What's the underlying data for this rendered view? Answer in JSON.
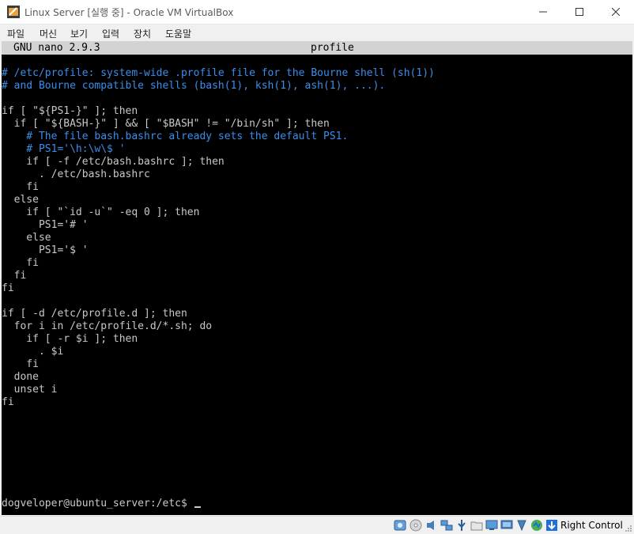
{
  "window": {
    "title": "Linux Server [실행 중] - Oracle VM VirtualBox"
  },
  "menu": {
    "items": [
      "파일",
      "머신",
      "보기",
      "입력",
      "장치",
      "도움말"
    ]
  },
  "nano": {
    "version": "GNU nano 2.9.3",
    "filename": "profile"
  },
  "file_lines": [
    "# /etc/profile: system-wide .profile file for the Bourne shell (sh(1))",
    "# and Bourne compatible shells (bash(1), ksh(1), ash(1), ...).",
    "",
    "if [ \"${PS1-}\" ]; then",
    "  if [ \"${BASH-}\" ] && [ \"$BASH\" != \"/bin/sh\" ]; then",
    "    # The file bash.bashrc already sets the default PS1.",
    "    # PS1='\\h:\\w\\$ '",
    "    if [ -f /etc/bash.bashrc ]; then",
    "      . /etc/bash.bashrc",
    "    fi",
    "  else",
    "    if [ \"`id -u`\" -eq 0 ]; then",
    "      PS1='# '",
    "    else",
    "      PS1='$ '",
    "    fi",
    "  fi",
    "fi",
    "",
    "if [ -d /etc/profile.d ]; then",
    "  for i in /etc/profile.d/*.sh; do",
    "    if [ -r $i ]; then",
    "      . $i",
    "    fi",
    "  done",
    "  unset i",
    "fi"
  ],
  "shell": {
    "prompt": "dogveloper@ubuntu_server:/etc$ "
  },
  "statusbar": {
    "host_key": "Right Control",
    "icons": [
      "hard-disk-icon",
      "optical-drive-icon",
      "audio-icon",
      "network-icon",
      "usb-icon",
      "shared-folders-icon",
      "display-icon",
      "video-capture-icon",
      "recording-icon",
      "mouse-integration-icon",
      "keyboard-capture-icon"
    ]
  },
  "colors": {
    "comment": "#3b8eea",
    "text": "#c8c8c8",
    "terminal_bg": "#000000",
    "nano_header_bg": "#d3d3d3"
  }
}
